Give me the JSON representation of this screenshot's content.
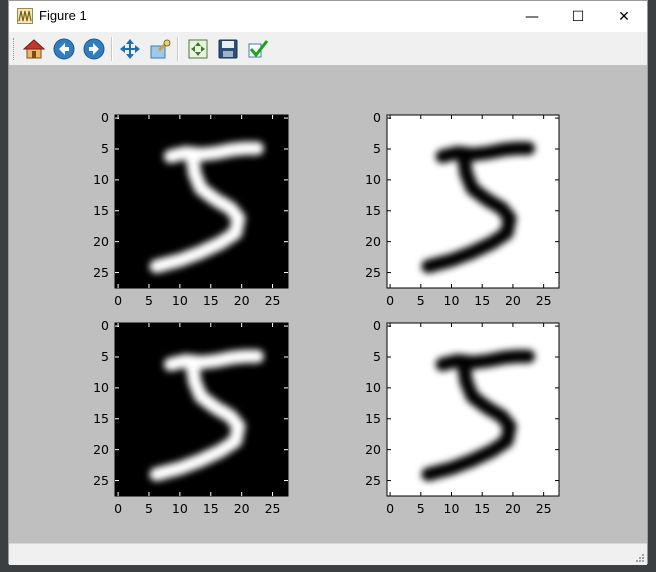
{
  "window": {
    "title": "Figure 1",
    "controls": {
      "minimize": "—",
      "maximize": "☐",
      "close": "✕"
    }
  },
  "toolbar": {
    "buttons": [
      {
        "name": "home-button",
        "icon": "home-icon"
      },
      {
        "name": "back-button",
        "icon": "back-arrow-icon"
      },
      {
        "name": "forward-button",
        "icon": "forward-arrow-icon"
      },
      {
        "name": "pan-button",
        "icon": "move-arrows-icon"
      },
      {
        "name": "zoom-button",
        "icon": "zoom-rect-icon"
      },
      {
        "name": "subplots-button",
        "icon": "configure-subplots-icon"
      },
      {
        "name": "save-button",
        "icon": "save-disk-icon"
      },
      {
        "name": "edit-button",
        "icon": "checkmark-icon"
      }
    ]
  },
  "chart_data": [
    {
      "type": "heatmap",
      "cmap": "gray",
      "image": "handwritten digit 5 (white on black)",
      "xticks": [
        "0",
        "5",
        "10",
        "15",
        "20",
        "25"
      ],
      "yticks": [
        "0",
        "5",
        "10",
        "15",
        "20",
        "25"
      ],
      "xlim": [
        -0.5,
        27.5
      ],
      "ylim": [
        27.5,
        -0.5
      ]
    },
    {
      "type": "heatmap",
      "cmap": "gray_r",
      "image": "handwritten digit 5 (black on white)",
      "xticks": [
        "0",
        "5",
        "10",
        "15",
        "20",
        "25"
      ],
      "yticks": [
        "0",
        "5",
        "10",
        "15",
        "20",
        "25"
      ],
      "xlim": [
        -0.5,
        27.5
      ],
      "ylim": [
        27.5,
        -0.5
      ]
    },
    {
      "type": "heatmap",
      "cmap": "gray",
      "image": "handwritten digit 5 (white on black)",
      "xticks": [
        "0",
        "5",
        "10",
        "15",
        "20",
        "25"
      ],
      "yticks": [
        "0",
        "5",
        "10",
        "15",
        "20",
        "25"
      ],
      "xlim": [
        -0.5,
        27.5
      ],
      "ylim": [
        27.5,
        -0.5
      ]
    },
    {
      "type": "heatmap",
      "cmap": "gray_r",
      "image": "handwritten digit 5 (black on white)",
      "xticks": [
        "0",
        "5",
        "10",
        "15",
        "20",
        "25"
      ],
      "yticks": [
        "0",
        "5",
        "10",
        "15",
        "20",
        "25"
      ],
      "xlim": [
        -0.5,
        27.5
      ],
      "ylim": [
        27.5,
        -0.5
      ]
    }
  ],
  "colors": {
    "figure_bg": "#bfbfbf",
    "stroke_dark": "#000000",
    "stroke_light": "#ffffff"
  }
}
